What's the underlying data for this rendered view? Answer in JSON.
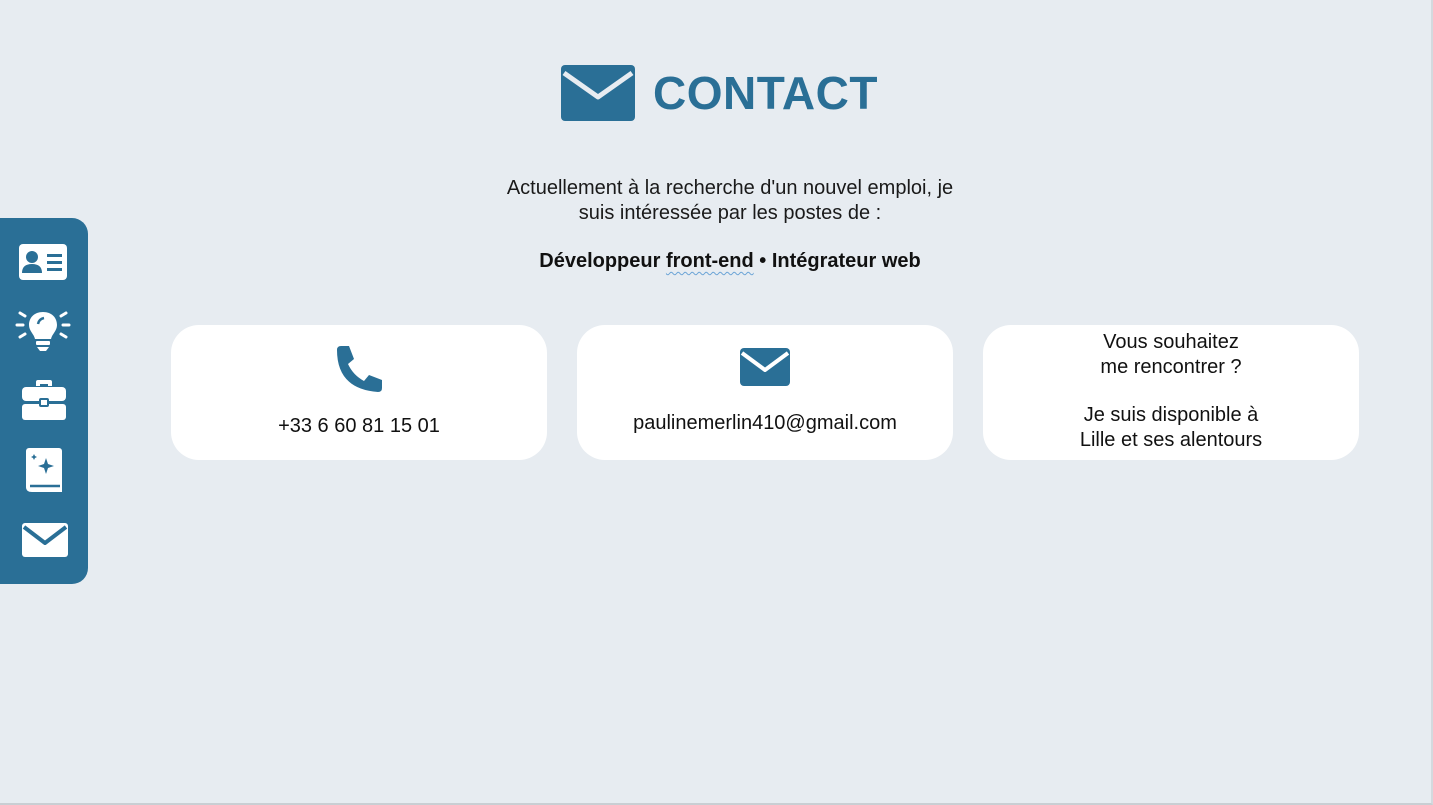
{
  "colors": {
    "accent": "#2a6f96",
    "background": "#e7ecf1",
    "card": "#ffffff"
  },
  "sidebar": {
    "items": [
      {
        "icon": "id-card-icon"
      },
      {
        "icon": "lightbulb-icon"
      },
      {
        "icon": "briefcase-icon"
      },
      {
        "icon": "book-sparkle-icon"
      },
      {
        "icon": "envelope-icon"
      }
    ]
  },
  "header": {
    "title": "CONTACT",
    "icon": "envelope-icon"
  },
  "intro": {
    "line1": "Actuellement à la recherche d'un nouvel emploi, je",
    "line2": "suis intéressée par les postes de :"
  },
  "jobs": {
    "part1": "Développeur ",
    "part2": "front-end",
    "part3": " • Intégrateur web"
  },
  "cards": {
    "phone": {
      "icon": "phone-icon",
      "text": "+33 6 60 81 15 01"
    },
    "email": {
      "icon": "envelope-icon",
      "text": "paulinemerlin410@gmail.com"
    },
    "meet": {
      "line1": "Vous souhaitez",
      "line2": "me rencontrer ?",
      "line3": "Je suis disponible à",
      "line4": "Lille et ses alentours"
    }
  }
}
